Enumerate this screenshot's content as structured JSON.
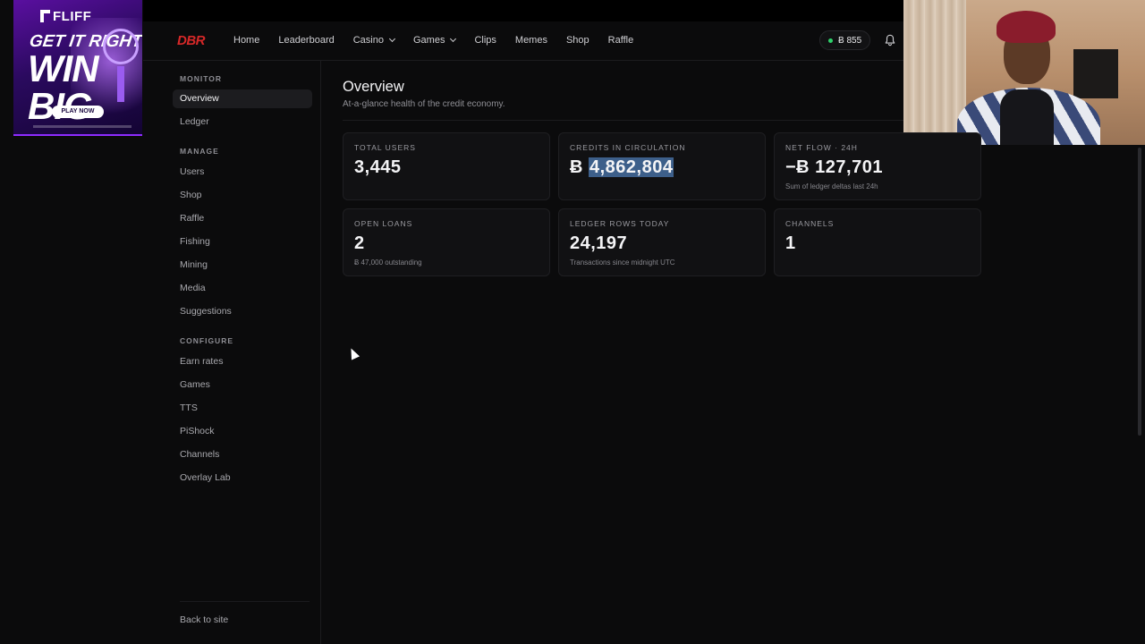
{
  "ad": {
    "brand": "FLIFF",
    "headline_1": "GET IT RIGHT",
    "headline_2": "WIN BIG",
    "cta": "PLAY NOW"
  },
  "nav": {
    "logo": "DBR",
    "links": [
      "Home",
      "Leaderboard",
      "Casino",
      "Games",
      "Clips",
      "Memes",
      "Shop",
      "Raffle"
    ],
    "balance": "Ƀ 855",
    "status_color": "#2fd16b"
  },
  "sidebar": {
    "monitor_label": "MONITOR",
    "monitor_items": [
      "Overview",
      "Ledger"
    ],
    "manage_label": "MANAGE",
    "manage_items": [
      "Users",
      "Shop",
      "Raffle",
      "Fishing",
      "Mining",
      "Media",
      "Suggestions"
    ],
    "configure_label": "CONFIGURE",
    "configure_items": [
      "Earn rates",
      "Games",
      "TTS",
      "PiShock",
      "Channels",
      "Overlay Lab"
    ],
    "back_link": "Back to site"
  },
  "main": {
    "title": "Overview",
    "subtitle": "At-a-glance health of the credit economy.",
    "cards": [
      {
        "label": "TOTAL USERS",
        "value": "3,445",
        "note": ""
      },
      {
        "label": "CREDITS IN CIRCULATION",
        "value_prefix": "Ƀ ",
        "value": "4,862,804",
        "note": ""
      },
      {
        "label": "NET FLOW · 24H",
        "value": "−Ƀ 127,701",
        "note": "Sum of ledger deltas last 24h"
      },
      {
        "label": "OPEN LOANS",
        "value": "2",
        "note": "Ƀ 47,000 outstanding"
      },
      {
        "label": "LEDGER ROWS TODAY",
        "value": "24,197",
        "note": "Transactions since midnight UTC"
      },
      {
        "label": "CHANNELS",
        "value": "1",
        "note": ""
      }
    ]
  },
  "colors": {
    "background": "#0b0b0c",
    "card": "#111113",
    "logo_red": "#d62828",
    "selection": "#3d5f8a"
  }
}
